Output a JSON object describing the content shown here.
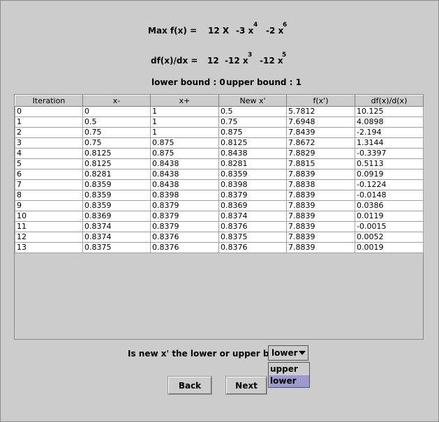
{
  "header": {
    "max_label": "Max  f(x) =",
    "max_terms": [
      "12  X",
      "-3  x",
      "-2  x"
    ],
    "max_exponents": [
      "4",
      "6"
    ],
    "deriv_label": "df(x)/dx =",
    "deriv_terms": [
      "12",
      "-12  x",
      "-12  x"
    ],
    "deriv_exponents": [
      "3",
      "5"
    ],
    "lower_bound": "lower bound : 0",
    "upper_bound": "upper bound : 1"
  },
  "table": {
    "columns": [
      "Iteration",
      "x-",
      "x+",
      "New x'",
      "f(x')",
      "df(x)/d(x)"
    ],
    "rows": [
      [
        "0",
        "0",
        "1",
        "0.5",
        "5.7812",
        "10.125"
      ],
      [
        "1",
        "0.5",
        "1",
        "0.75",
        "7.6948",
        "4.0898"
      ],
      [
        "2",
        "0.75",
        "1",
        "0.875",
        "7.8439",
        "-2.194"
      ],
      [
        "3",
        "0.75",
        "0.875",
        "0.8125",
        "7.8672",
        "1.3144"
      ],
      [
        "4",
        "0.8125",
        "0.875",
        "0.8438",
        "7.8829",
        "-0.3397"
      ],
      [
        "5",
        "0.8125",
        "0.8438",
        "0.8281",
        "7.8815",
        "0.5113"
      ],
      [
        "6",
        "0.8281",
        "0.8438",
        "0.8359",
        "7.8839",
        "0.0919"
      ],
      [
        "7",
        "0.8359",
        "0.8438",
        "0.8398",
        "7.8838",
        "-0.1224"
      ],
      [
        "8",
        "0.8359",
        "0.8398",
        "0.8379",
        "7.8839",
        "-0.0148"
      ],
      [
        "9",
        "0.8359",
        "0.8379",
        "0.8369",
        "7.8839",
        "0.0386"
      ],
      [
        "10",
        "0.8369",
        "0.8379",
        "0.8374",
        "7.8839",
        "0.0119"
      ],
      [
        "11",
        "0.8374",
        "0.8379",
        "0.8376",
        "7.8839",
        "-0.0015"
      ],
      [
        "12",
        "0.8374",
        "0.8376",
        "0.8375",
        "7.8839",
        "0.0052"
      ],
      [
        "13",
        "0.8375",
        "0.8376",
        "0.8376",
        "7.8839",
        "0.0019"
      ]
    ]
  },
  "bound_select": {
    "question": "Is new x' the lower or upper bound",
    "selected": "lower",
    "options": [
      "upper",
      "lower"
    ]
  },
  "buttons": {
    "back": "Back",
    "next": "Next"
  },
  "colors": {
    "background": "#cccccc",
    "selection": "#9c9acd"
  }
}
